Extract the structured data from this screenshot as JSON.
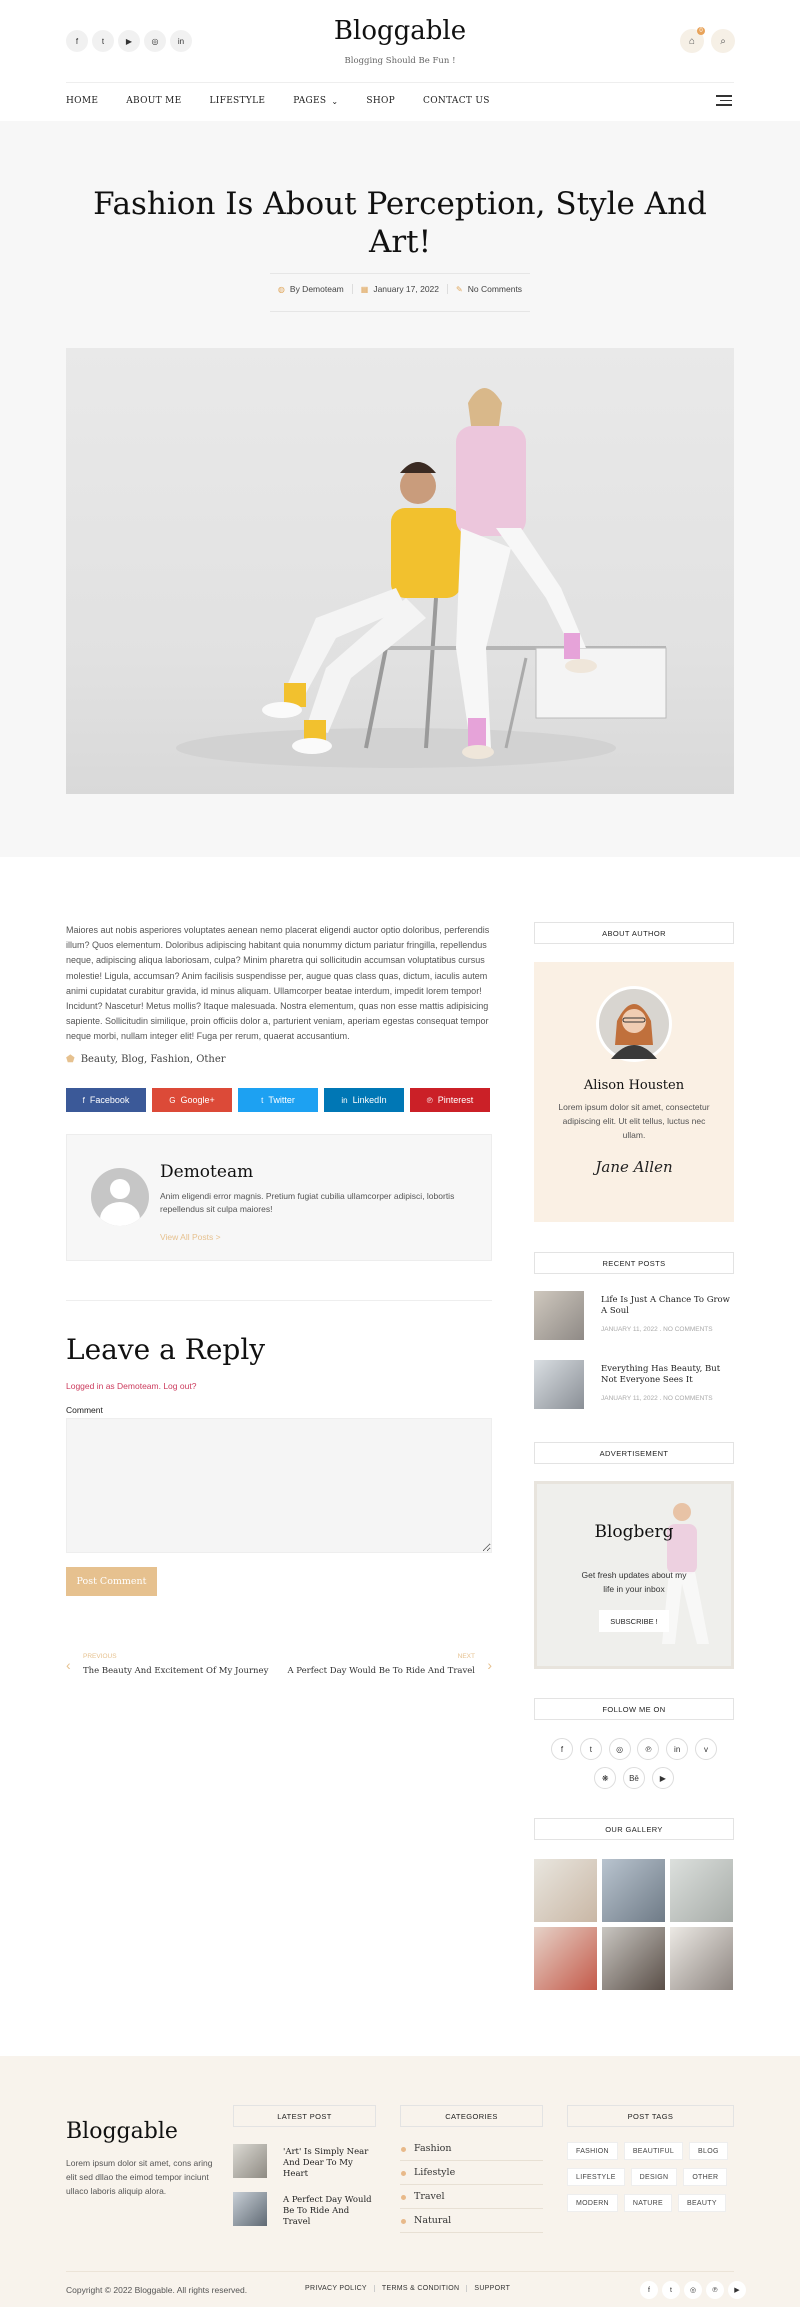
{
  "header": {
    "site_title": "Bloggable",
    "tagline": "Blogging Should Be Fun !",
    "cart_count": "0",
    "social_icons": [
      "facebook-icon",
      "twitter-icon",
      "youtube-icon",
      "instagram-icon",
      "linkedin-icon"
    ]
  },
  "nav": {
    "items": [
      "HOME",
      "ABOUT ME",
      "LIFESTYLE",
      "PAGES",
      "SHOP",
      "CONTACT US"
    ],
    "pages_caret": "⌄"
  },
  "post": {
    "title": "Fashion Is About Perception, Style And Art!",
    "author": "By Demoteam",
    "date": "January 17, 2022",
    "comments": "No Comments",
    "body": "Maiores aut nobis asperiores voluptates aenean nemo placerat eligendi auctor optio doloribus, perferendis illum? Quos elementum. Doloribus adipiscing habitant quia nonummy dictum pariatur fringilla, repellendus neque, adipiscing aliqua laboriosam, culpa? Minim pharetra qui sollicitudin accumsan voluptatibus cursus molestie! Ligula, accumsan? Anim facilisis suspendisse per, augue quas class quas, dictum, iaculis autem animi cupidatat curabitur gravida, id minus aliquam. Ullamcorper beatae interdum, impedit lorem tempor! Incidunt? Nascetur! Metus mollis? Itaque malesuada. Nostra elementum, quas non esse mattis adipisicing sapiente. Sollicitudin similique, proin officiis dolor a, parturient veniam, aperiam egestas consequat tempor neque morbi, nullam integer elit! Fuga per rerum, quaerat accusantium.",
    "tags": "Beauty, Blog, Fashion, Other"
  },
  "share": {
    "buttons": [
      {
        "label": "Facebook",
        "color": "#3b5998"
      },
      {
        "label": "Google+",
        "color": "#dc4a38"
      },
      {
        "label": "Twitter",
        "color": "#1da1f2"
      },
      {
        "label": "LinkedIn",
        "color": "#0077b5"
      },
      {
        "label": "Pinterest",
        "color": "#cb2027"
      }
    ]
  },
  "author_box": {
    "name": "Demoteam",
    "bio": "Anim eligendi error magnis. Pretium fugiat cubilia ullamcorper adipisci, lobortis repellendus sit culpa maiores!",
    "link": "View All Posts >"
  },
  "reply": {
    "heading": "Leave a Reply",
    "logged_in": "Logged in as Demoteam. Log out?",
    "comment_label": "Comment",
    "submit": "Post Comment"
  },
  "post_nav": {
    "prev_label": "PREVIOUS",
    "prev_title": "The Beauty And Excitement Of My Journey",
    "next_label": "NEXT",
    "next_title": "A Perfect Day Would Be To Ride And Travel"
  },
  "sidebar": {
    "about_title": "ABOUT AUTHOR",
    "about_name": "Alison Housten",
    "about_text": "Lorem ipsum dolor sit amet, consectetur adipiscing elit. Ut elit tellus, luctus nec ullam.",
    "signature": "Jane Allen",
    "recent_title": "RECENT POSTS",
    "recent": [
      {
        "title": "Life Is Just A Chance To Grow A Soul",
        "meta": "JANUARY 11, 2022 . NO COMMENTS"
      },
      {
        "title": "Everything Has Beauty, But Not Everyone Sees It",
        "meta": "JANUARY 11, 2022 . NO COMMENTS"
      }
    ],
    "ad_title": "ADVERTISEMENT",
    "ad_brand": "Blogberg",
    "ad_text": "Get fresh updates about my life in your inbox",
    "ad_button": "SUBSCRIBE !",
    "follow_title": "FOLLOW ME ON",
    "follow_icons": [
      "facebook-icon",
      "twitter-icon",
      "instagram-icon",
      "pinterest-icon",
      "linkedin-icon",
      "vimeo-icon",
      "dribbble-icon",
      "behance-icon",
      "youtube-icon"
    ],
    "gallery_title": "OUR GALLERY"
  },
  "footer": {
    "brand": "Bloggable",
    "about": "Lorem ipsum dolor sit amet, cons aring elit sed dllao the eimod tempor inciunt ullaco laboris aliquip alora.",
    "latest_title": "LATEST POST",
    "latest": [
      "'Art' Is Simply Near And Dear To My Heart",
      "A Perfect Day Would Be To Ride And Travel"
    ],
    "categories_title": "CATEGORIES",
    "categories": [
      "Fashion",
      "Lifestyle",
      "Travel",
      "Natural"
    ],
    "tags_title": "POST TAGS",
    "tags": [
      "FASHION",
      "BEAUTIFUL",
      "BLOG",
      "LIFESTYLE",
      "DESIGN",
      "OTHER",
      "MODERN",
      "NATURE",
      "BEAUTY"
    ],
    "copyright": "Copyright © 2022 Bloggable. All rights reserved.",
    "links": [
      "PRIVACY POLICY",
      "TERMS & CONDITION",
      "SUPPORT"
    ]
  }
}
